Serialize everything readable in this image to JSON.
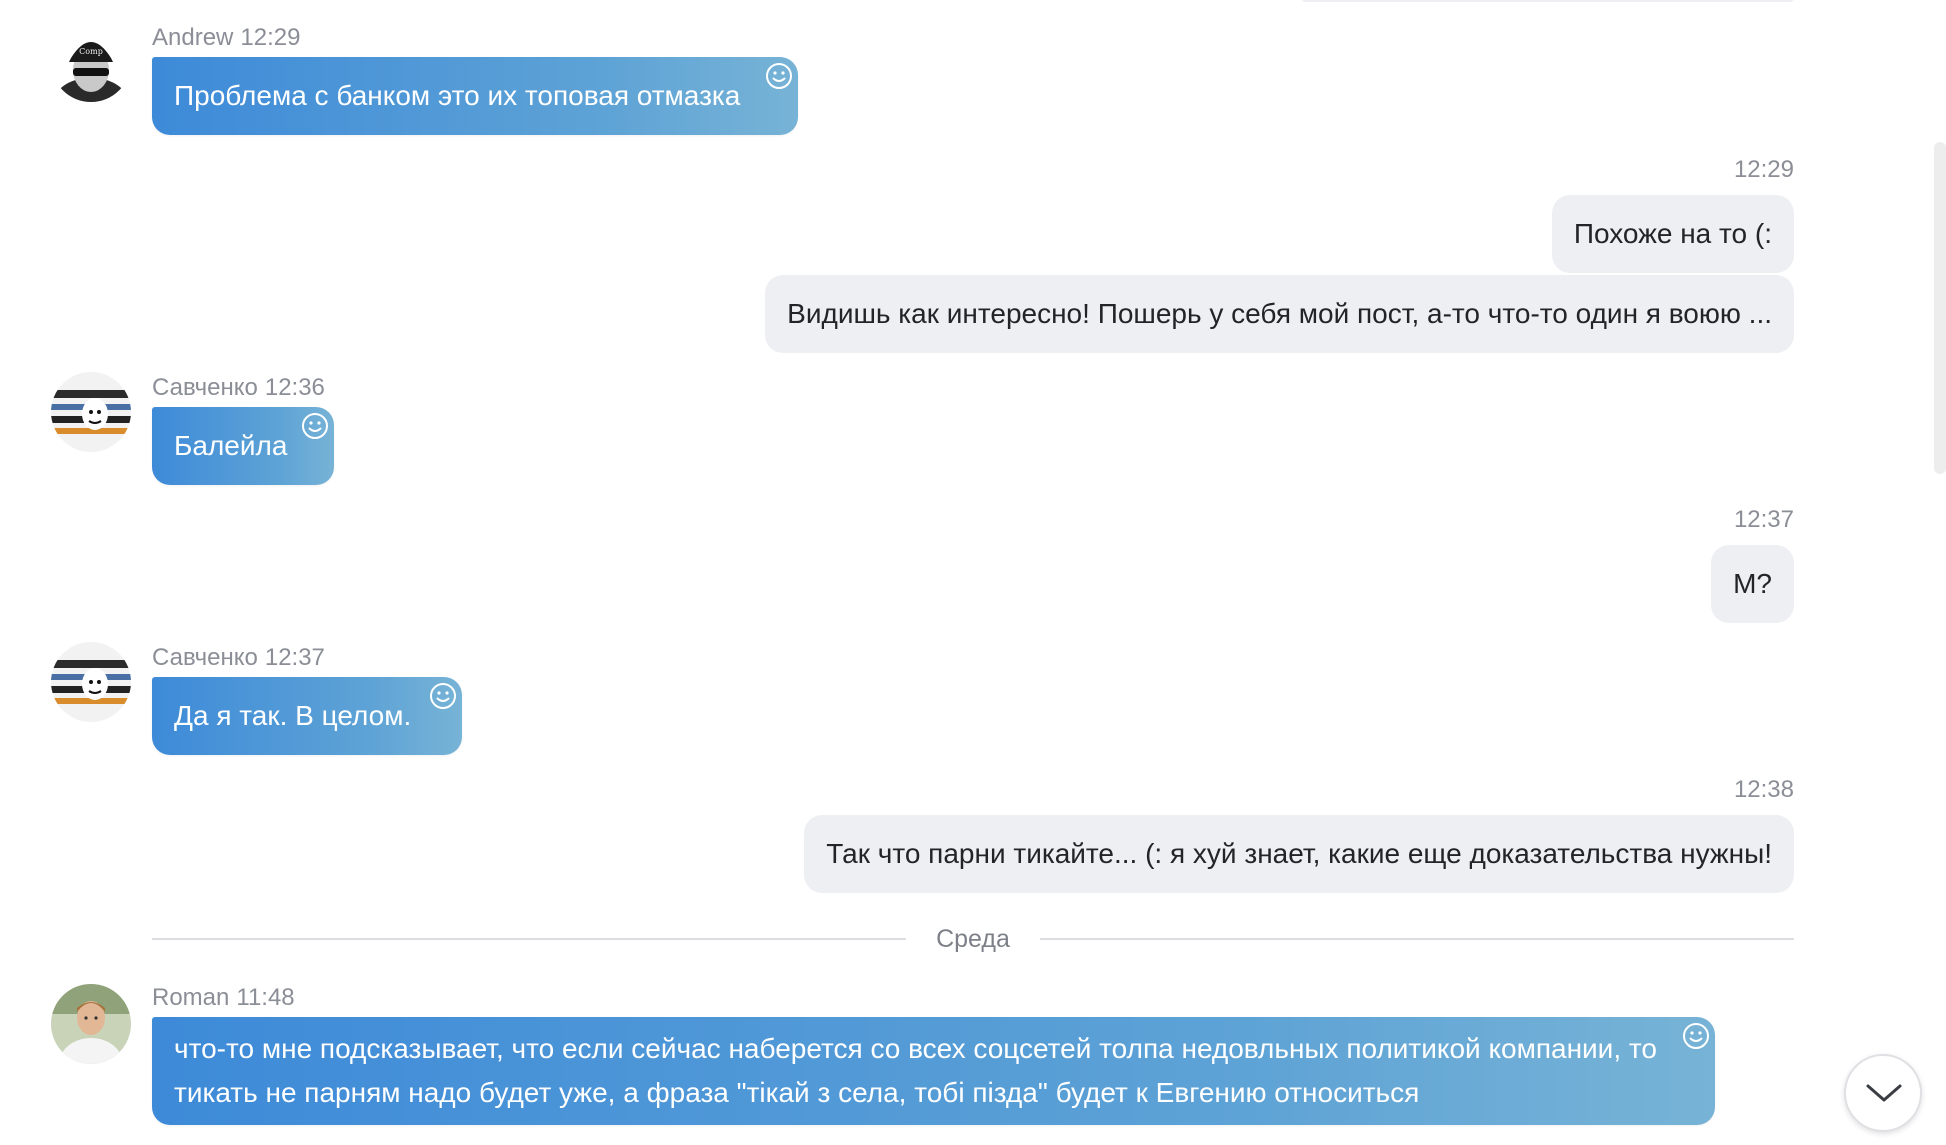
{
  "colors": {
    "incoming_bubble_start": "#3d8ad8",
    "incoming_bubble_end": "#77b3d6",
    "outgoing_bubble": "#eeeff3",
    "meta_text": "#8b8e96"
  },
  "messages": {
    "m1": {
      "sender": "Andrew",
      "time": "12:29",
      "text": "Проблема с банком это их топовая отмазка",
      "avatar": "avatar-andrew"
    },
    "out1": {
      "time": "12:29",
      "text": "Похоже на то (:"
    },
    "out2": {
      "text": "Видишь как интересно! Пошерь у себя мой пост, а-то что-то один я воюю ..."
    },
    "m2": {
      "sender": "Савченко",
      "time": "12:36",
      "text": "Балейла",
      "avatar": "avatar-savchenko"
    },
    "out3": {
      "time": "12:37",
      "text": "М?"
    },
    "m3": {
      "sender": "Савченко",
      "time": "12:37",
      "text": "Да я так. В целом.",
      "avatar": "avatar-savchenko"
    },
    "out4": {
      "time": "12:38",
      "text": "Так что парни тикайте... (: я хуй знает, какие еще доказательства нужны!"
    },
    "m4": {
      "sender": "Roman",
      "time": "11:48",
      "text": "что-то мне подсказывает, что если сейчас наберется со всех соцсетей толпа недовльных политикой компании, то тикать не парням надо будет уже, а фраза \"тікай з села, тобі пізда\" будет к Евгению относиться",
      "avatar": "avatar-roman"
    }
  },
  "day_divider": {
    "label": "Среда"
  },
  "icons": {
    "reaction": "smiley-icon",
    "scroll": "chevron-down-icon"
  }
}
